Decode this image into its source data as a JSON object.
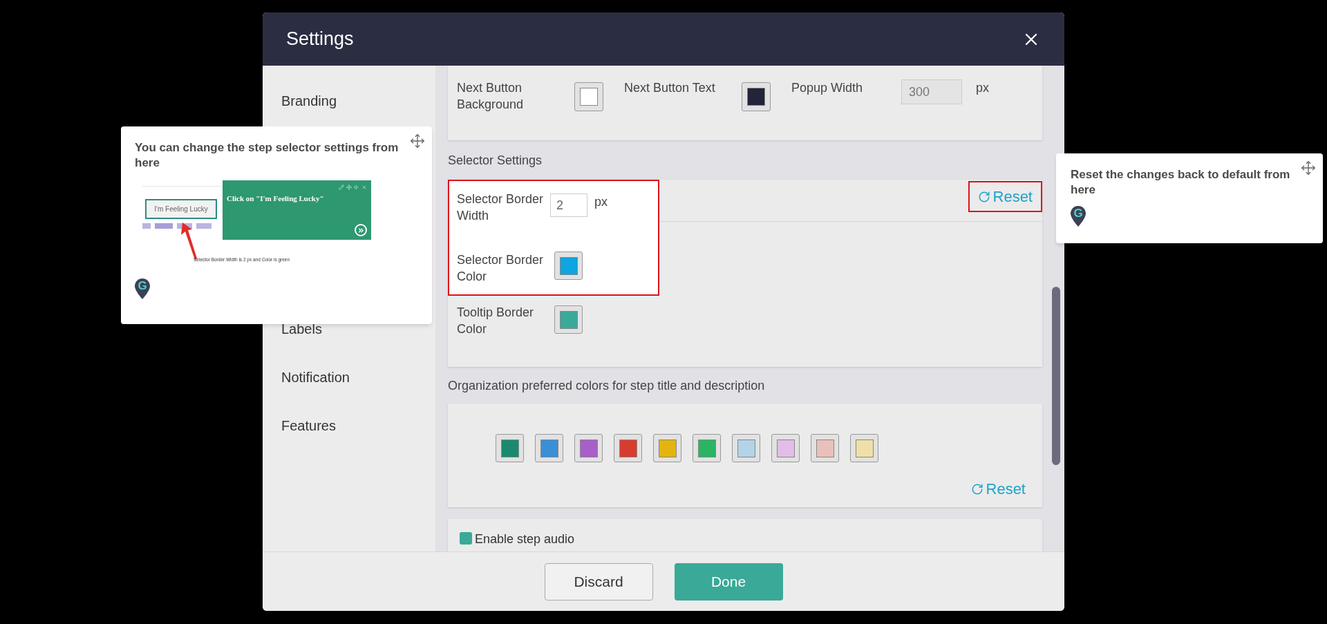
{
  "window": {
    "title": "Settings"
  },
  "sidebar": {
    "items": [
      {
        "label": "Branding"
      },
      {
        "label": "Labels"
      },
      {
        "label": "Notification"
      },
      {
        "label": "Features"
      }
    ]
  },
  "appearance": {
    "fields": [
      {
        "kind": "color",
        "label": "Next Button Background",
        "color": "#ffffff"
      },
      {
        "kind": "color",
        "label": "Next Button Text",
        "color": "#23233a"
      },
      {
        "kind": "number",
        "label": "Popup Width",
        "value": "300",
        "unit": "px"
      }
    ]
  },
  "selector_settings": {
    "heading": "Selector Settings",
    "highlighted": true,
    "border_width": {
      "label": "Selector Border Width",
      "value": "2",
      "unit": "px"
    },
    "colors": [
      {
        "label": "Selector Border Color",
        "color": "#0ea5e0"
      },
      {
        "label": "Tooltip Border Color",
        "color": "#3aa99a"
      }
    ],
    "reset": {
      "label": "Reset",
      "highlighted": true
    }
  },
  "org_colors": {
    "heading": "Organization preferred colors for step title and description",
    "swatches": [
      {
        "color": "#1a8a6e"
      },
      {
        "color": "#3a8fd6"
      },
      {
        "color": "#a85fc8"
      },
      {
        "color": "#d83c2e"
      },
      {
        "color": "#e3b40f"
      },
      {
        "color": "#2bb463"
      },
      {
        "color": "#b3d3e8"
      },
      {
        "color": "#e2bde8"
      },
      {
        "color": "#e9c0ba"
      },
      {
        "color": "#f0e0a8"
      }
    ],
    "reset": {
      "label": "Reset"
    }
  },
  "audio": {
    "label": "Enable step audio",
    "checked": true
  },
  "footer": {
    "buttons": [
      {
        "label": "Discard",
        "kind": "secondary"
      },
      {
        "label": "Done",
        "kind": "primary"
      }
    ]
  },
  "tooltips": [
    {
      "text": "You can change the step selector settings from here",
      "logo": "G",
      "preview": {
        "button": "I'm Feeling Lucky",
        "bubble": "Click on \"I'm Feeling Lucky\"",
        "caption": "Selector Border Width is 2 px and Color is green"
      }
    },
    {
      "text": "Reset the changes back to default from here",
      "logo": "G"
    }
  ]
}
